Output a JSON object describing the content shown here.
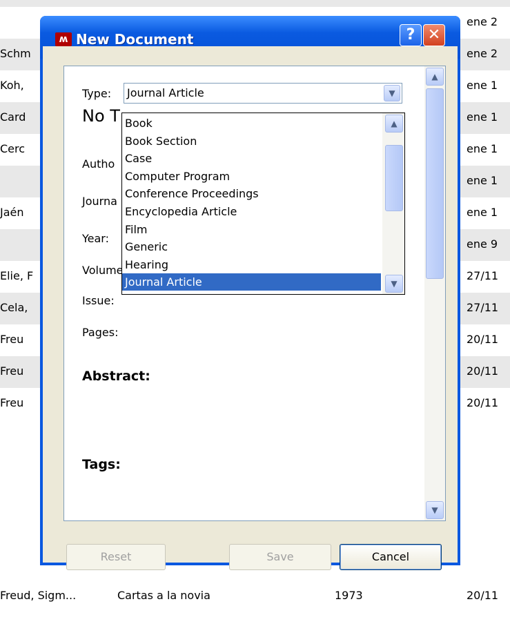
{
  "background": {
    "rows": [
      {
        "author": "",
        "date": "ene 2"
      },
      {
        "author": "Schm",
        "date": "ene 2"
      },
      {
        "author": "Koh,",
        "date": "ene 1"
      },
      {
        "author": "Card",
        "date": "ene 1"
      },
      {
        "author": "Cerc",
        "date": "ene 1"
      },
      {
        "author": "",
        "date": "ene 1"
      },
      {
        "author": "Jaén",
        "date": "ene 1"
      },
      {
        "author": "",
        "date": "ene 9"
      },
      {
        "author": "Elie, F",
        "date": "27/11"
      },
      {
        "author": "Cela,",
        "date": "27/11"
      },
      {
        "author": "Freu",
        "date": "20/11"
      },
      {
        "author": "Freu",
        "date": "20/11"
      },
      {
        "author": "Freu",
        "date": "20/11"
      }
    ],
    "last_row": {
      "author": "Freud, Sigm...",
      "title": "Cartas a la novia",
      "year": "1973",
      "date": "20/11"
    }
  },
  "dialog": {
    "title": "New Document",
    "app_icon": "mendeley-icon",
    "help_label": "?",
    "close_label": "✕",
    "fields": {
      "type_label": "Type:",
      "type_value": "Journal Article",
      "no_title": "No T",
      "authors_label": "Autho",
      "journal_label": "Journa",
      "year_label": "Year:",
      "volume_label": "Volume",
      "issue_label": "Issue:",
      "pages_label": "Pages:",
      "abstract_heading": "Abstract:",
      "tags_heading": "Tags:"
    },
    "type_options": [
      "Book",
      "Book Section",
      "Case",
      "Computer Program",
      "Conference Proceedings",
      "Encyclopedia Article",
      "Film",
      "Generic",
      "Hearing",
      "Journal Article"
    ],
    "selected_option": "Journal Article",
    "buttons": {
      "reset": "Reset",
      "save": "Save",
      "cancel": "Cancel"
    }
  },
  "icons": {
    "dropdown": "chevron-down-icon",
    "scroll_up": "chevron-up-icon",
    "scroll_down": "chevron-down-icon"
  },
  "colors": {
    "titlebar": "#0a5ae0",
    "selection": "#316ac5",
    "dialog_face": "#ece9d8",
    "row_shade": "#e8e8e8"
  }
}
